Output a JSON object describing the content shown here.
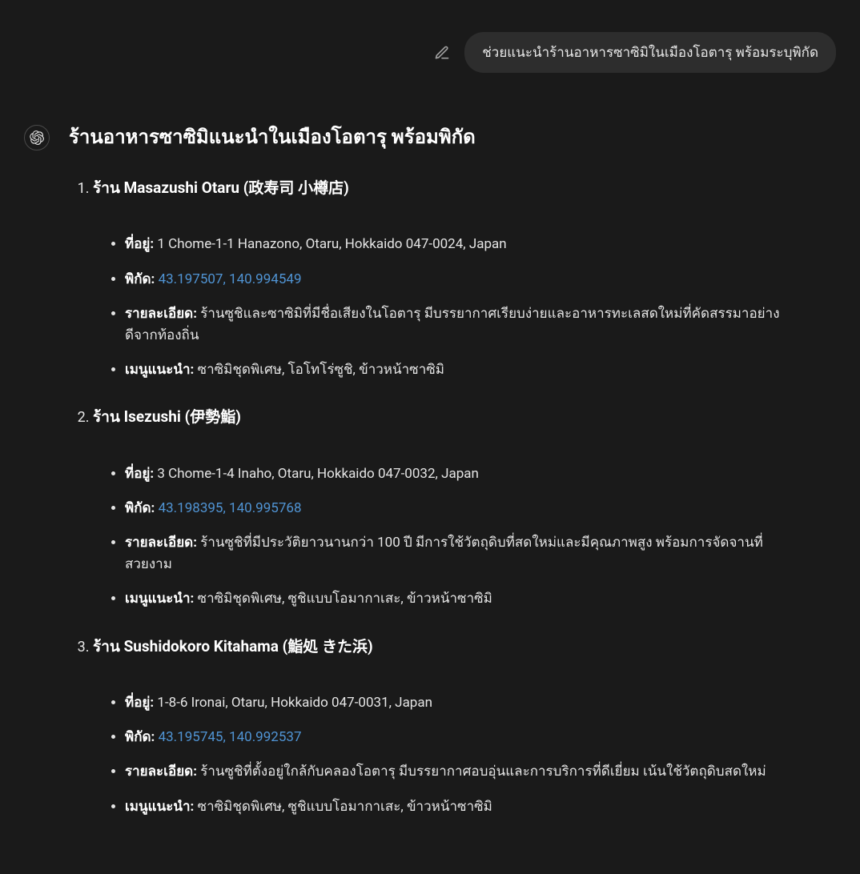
{
  "user_message": "ช่วยแนะนำร้านอาหารซาซิมิในเมืองโอตารุ พร้อมระบุพิกัด",
  "heading": "ร้านอาหารซาซิมิแนะนำในเมืองโอตารุ พร้อมพิกัด",
  "labels": {
    "address": "ที่อยู่:",
    "coords": "พิกัด:",
    "details": "รายละเอียด:",
    "menu": "เมนูแนะนำ:"
  },
  "restaurants": [
    {
      "name": "ร้าน Masazushi Otaru (政寿司 小樽店)",
      "address": "1 Chome-1-1 Hanazono, Otaru, Hokkaido 047-0024, Japan",
      "coords": "43.197507, 140.994549",
      "details": "ร้านซูชิและซาซิมิที่มีชื่อเสียงในโอตารุ มีบรรยากาศเรียบง่ายและอาหารทะเลสดใหม่ที่คัดสรรมาอย่างดีจากท้องถิ่น",
      "menu": "ซาซิมิชุดพิเศษ, โอโทโร่ซูชิ, ข้าวหน้าซาซิมิ"
    },
    {
      "name": "ร้าน Isezushi (伊勢鮨)",
      "address": "3 Chome-1-4 Inaho, Otaru, Hokkaido 047-0032, Japan",
      "coords": "43.198395, 140.995768",
      "details": "ร้านซูชิที่มีประวัติยาวนานกว่า 100 ปี มีการใช้วัตถุดิบที่สดใหม่และมีคุณภาพสูง พร้อมการจัดจานที่สวยงาม",
      "menu": "ซาซิมิชุดพิเศษ, ซูชิแบบโอมากาเสะ, ข้าวหน้าซาซิมิ"
    },
    {
      "name": "ร้าน Sushidokoro Kitahama (鮨処 きた浜)",
      "address": "1-8-6 Ironai, Otaru, Hokkaido 047-0031, Japan",
      "coords": "43.195745, 140.992537",
      "details": "ร้านซูชิที่ตั้งอยู่ใกล้กับคลองโอตารุ มีบรรยากาศอบอุ่นและการบริการที่ดีเยี่ยม เน้นใช้วัตถุดิบสดใหม่",
      "menu": "ซาซิมิชุดพิเศษ, ซูชิแบบโอมากาเสะ, ข้าวหน้าซาซิมิ"
    }
  ]
}
